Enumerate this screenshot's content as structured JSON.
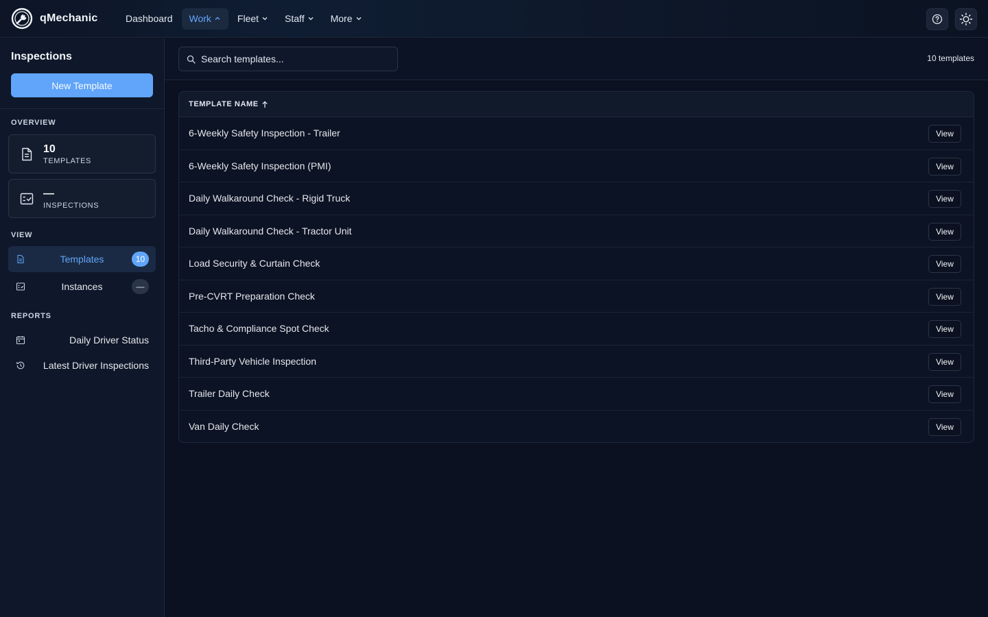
{
  "app": {
    "name": "qMechanic"
  },
  "nav": {
    "items": [
      {
        "label": "Dashboard",
        "active": false,
        "chevron": ""
      },
      {
        "label": "Work",
        "active": true,
        "chevron": "up"
      },
      {
        "label": "Fleet",
        "active": false,
        "chevron": "down"
      },
      {
        "label": "Staff",
        "active": false,
        "chevron": "down"
      },
      {
        "label": "More",
        "active": false,
        "chevron": "down"
      }
    ]
  },
  "top_actions": {
    "icons": [
      "help-circle-icon",
      "sun-icon"
    ]
  },
  "sidebar": {
    "title": "Inspections",
    "new_button": "New Template",
    "overview_label": "OVERVIEW",
    "stats": [
      {
        "value": "10",
        "label": "TEMPLATES",
        "icon": "document-icon"
      },
      {
        "value": "—",
        "label": "INSPECTIONS",
        "icon": "checklist-icon"
      }
    ],
    "view_label": "VIEW",
    "views": [
      {
        "label": "Templates",
        "count": "10",
        "active": true,
        "icon": "document-icon"
      },
      {
        "label": "Instances",
        "count": "—",
        "active": false,
        "icon": "checklist-icon"
      }
    ],
    "reports_label": "REPORTS",
    "reports": [
      {
        "label": "Daily Driver Status",
        "icon": "calendar-icon"
      },
      {
        "label": "Latest Driver Inspections",
        "icon": "history-icon"
      }
    ]
  },
  "main": {
    "search_placeholder": "Search templates...",
    "search_value": "",
    "count_text": "10 templates",
    "table": {
      "column_header": "TEMPLATE NAME",
      "sort": "ascending",
      "action_label": "View",
      "rows": [
        "6-Weekly Safety Inspection - Trailer",
        "6-Weekly Safety Inspection (PMI)",
        "Daily Walkaround Check - Rigid Truck",
        "Daily Walkaround Check - Tractor Unit",
        "Load Security & Curtain Check",
        "Pre-CVRT Preparation Check",
        "Tacho & Compliance Spot Check",
        "Third-Party Vehicle Inspection",
        "Trailer Daily Check",
        "Van Daily Check"
      ]
    }
  },
  "colors": {
    "accent": "#60a5fa",
    "background": "#0b1120",
    "sidebar": "#0f172a",
    "border": "#1e293b"
  }
}
